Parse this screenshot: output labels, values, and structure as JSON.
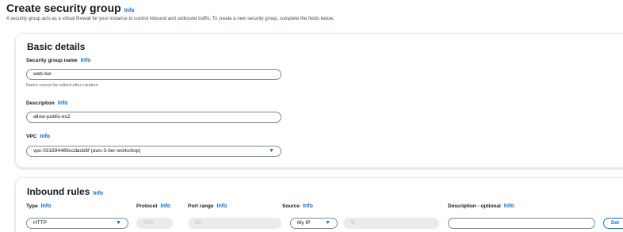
{
  "page": {
    "title": "Create security group",
    "info": "Info",
    "description": "A security group acts as a virtual firewall for your instance to control inbound and outbound traffic. To create a new security group, complete the fields below."
  },
  "basic_details": {
    "title": "Basic details",
    "name_label": "Security group name",
    "name_value": "web-tier",
    "name_hint": "Name cannot be edited after creation.",
    "description_label": "Description",
    "description_value": "allow-public-ec2",
    "vpc_label": "VPC",
    "vpc_value": "vpc-031694486ccdacb6f (aws-3-tier-workshop)"
  },
  "inbound_rules": {
    "title": "Inbound rules",
    "columns": {
      "type": "Type",
      "protocol": "Protocol",
      "port_range": "Port range",
      "source": "Source",
      "description": "Description - optional"
    },
    "row": {
      "type": "HTTP",
      "protocol": "TCP",
      "port_range": "80",
      "source": "My IP",
      "source_search": "",
      "description": "",
      "delete_label": "Del"
    }
  },
  "info_label": "Info",
  "icons": {
    "caret": "caret-down-icon",
    "search": "search-icon"
  },
  "colors": {
    "link": "#0972d3",
    "border": "#7d8998",
    "disabled_bg": "#e9ebed",
    "text": "#16191f"
  }
}
